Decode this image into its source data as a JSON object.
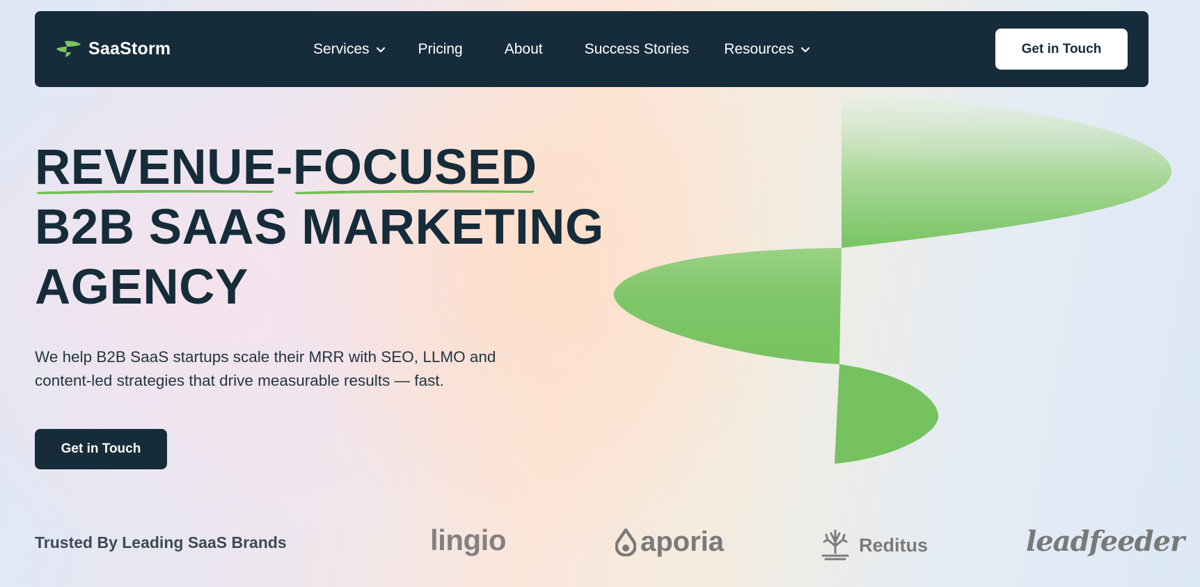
{
  "nav": {
    "brand_name": "SaaStorm",
    "items": [
      {
        "label": "Services"
      },
      {
        "label": "Pricing"
      },
      {
        "label": "About"
      },
      {
        "label": "Success Stories"
      },
      {
        "label": "Resources"
      }
    ],
    "cta_label": "Get in Touch"
  },
  "hero": {
    "title_part1": "REVENUE",
    "title_dash": "-",
    "title_part2": "FOCUSED",
    "title_line2": "B2B SAAS MARKETING",
    "title_line3": "AGENCY",
    "subtitle_line1": "We help B2B SaaS startups scale their MRR with SEO, LLMO and",
    "subtitle_line2": "content-led strategies that drive measurable results — fast.",
    "cta_label": "Get in Touch"
  },
  "trusted": {
    "label": "Trusted By Leading SaaS Brands",
    "logos": [
      {
        "name": "lingio"
      },
      {
        "name": "aporia"
      },
      {
        "name": "Reditus"
      },
      {
        "name": "leadfeeder"
      }
    ]
  },
  "colors": {
    "navy": "#162c3a",
    "accent_green": "#7cc463",
    "white": "#ffffff",
    "logo_gray": "#7a7a7a"
  },
  "icons": {
    "brand": "saastorm-logo-icon",
    "dropdown": "chevron-down-icon",
    "hero_art": "storm-shape-illustration"
  }
}
